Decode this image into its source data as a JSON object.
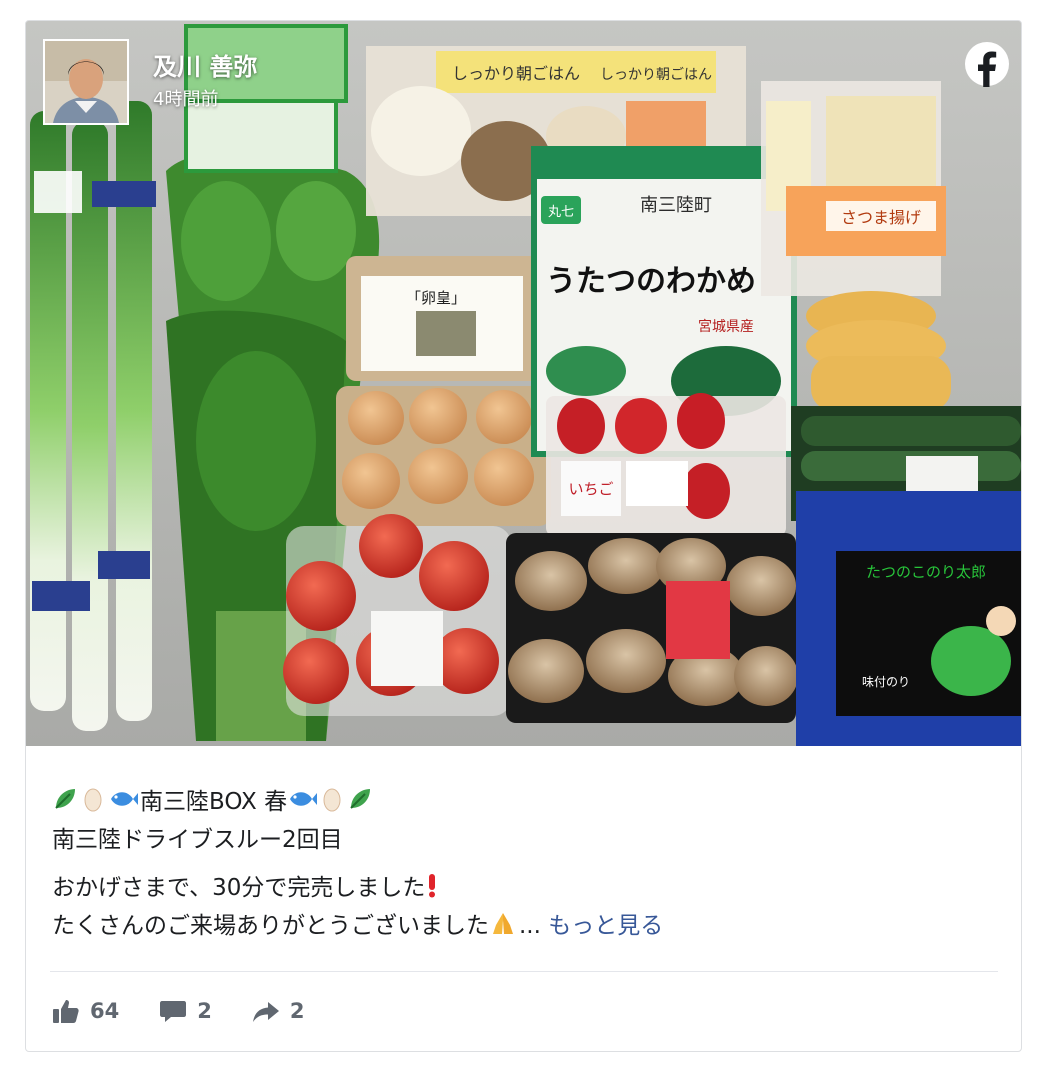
{
  "post": {
    "author": "及川 善弥",
    "time": "4時間前",
    "brand_icon": "facebook-icon",
    "caption": {
      "line1_text": "南三陸BOX 春",
      "line1_emojis": [
        "leafy-green-emoji",
        "egg-emoji",
        "fish-emoji"
      ],
      "line2": "南三陸ドライブスルー2回目",
      "line3": "おかげさまで、30分で完売しました",
      "line3_emoji": "exclamation-emoji",
      "line4": "たくさんのご来場ありがとうございました",
      "line4_emoji": "folded-hands-emoji",
      "ellipsis": "...",
      "see_more": "もっと見る"
    },
    "photo_labels": {
      "package_title_1": "しっかり朝ごはん",
      "package_title_2": "しっかり朝ごはん",
      "egg_label": "「卵皇」",
      "wakame_brand": "丸七",
      "wakame_town": "南三陸町",
      "wakame_product": "うたつのわかめ",
      "wakame_origin": "宮城県産",
      "satsuma": "さつま揚げ",
      "strawberry": "いちご",
      "nori_brand": "たつのこのり太郎",
      "nori_type": "味付のり"
    },
    "stats": {
      "likes": "64",
      "comments": "2",
      "shares": "2"
    }
  },
  "colors": {
    "link": "#385898",
    "text": "#1c1e21",
    "muted": "#606770",
    "divider": "#e4e6eb"
  }
}
